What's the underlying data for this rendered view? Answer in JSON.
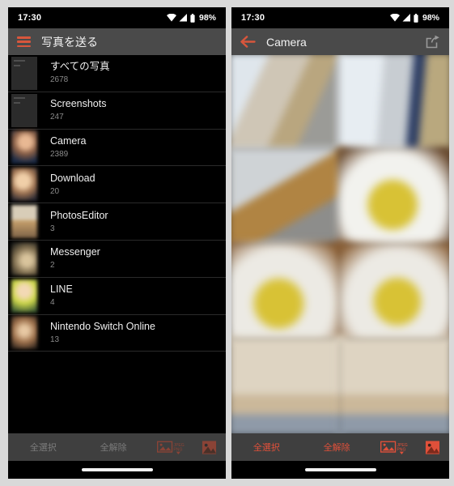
{
  "statusbar": {
    "time": "17:30",
    "battery": "98%",
    "icons": [
      "wifi-icon",
      "signal-icon",
      "battery-icon"
    ]
  },
  "left_phone": {
    "appbar": {
      "menu_icon": "hamburger-icon",
      "title": "写真を送る"
    },
    "albums": [
      {
        "name": "すべての写真",
        "count": "2678",
        "thumb_style": "dark"
      },
      {
        "name": "Screenshots",
        "count": "247",
        "thumb_style": "dark"
      },
      {
        "name": "Camera",
        "count": "2389",
        "thumb_style": "photo-a"
      },
      {
        "name": "Download",
        "count": "20",
        "thumb_style": "photo-b"
      },
      {
        "name": "PhotosEditor",
        "count": "3",
        "thumb_style": "photo-c"
      },
      {
        "name": "Messenger",
        "count": "2",
        "thumb_style": "photo-d"
      },
      {
        "name": "LINE",
        "count": "4",
        "thumb_style": "photo-e"
      },
      {
        "name": "Nintendo Switch Online",
        "count": "13",
        "thumb_style": "photo-f"
      }
    ],
    "toolbar": {
      "select_all": "全選択",
      "deselect_all": "全解除",
      "convert_icon": "jpeg-png-convert-icon",
      "convert_icon_label_top": "JPEG",
      "convert_icon_label_bottom": "PNG",
      "photo_icon": "photo-icon",
      "state": "disabled"
    }
  },
  "right_phone": {
    "appbar": {
      "back_icon": "back-arrow-icon",
      "title": "Camera",
      "share_icon": "share-icon"
    },
    "photos": [
      {
        "id": "photo-1",
        "alt": "blurred room interior"
      },
      {
        "id": "photo-2",
        "alt": "blurred room interior"
      },
      {
        "id": "photo-3",
        "alt": "blurred hallway floor"
      },
      {
        "id": "photo-4",
        "alt": "blurred baby in yellow"
      },
      {
        "id": "photo-5",
        "alt": "blurred baby in yellow on mat"
      },
      {
        "id": "photo-6",
        "alt": "blurred baby in yellow on mat"
      },
      {
        "id": "photo-7",
        "alt": "blurred tatami room"
      },
      {
        "id": "photo-8",
        "alt": "blurred tatami room"
      }
    ],
    "toolbar": {
      "select_all": "全選択",
      "deselect_all": "全解除",
      "convert_icon": "jpeg-png-convert-icon",
      "convert_icon_label_top": "JPEG",
      "convert_icon_label_bottom": "PNG",
      "photo_icon": "photo-icon",
      "state": "enabled"
    }
  },
  "colors": {
    "accent": "#e0503a",
    "appbar": "#4a4a4a",
    "toolbar": "#3f3f3f",
    "page_background": "#d9d9d9",
    "screen_background": "#000000",
    "disabled_text": "#7b7b7b"
  }
}
